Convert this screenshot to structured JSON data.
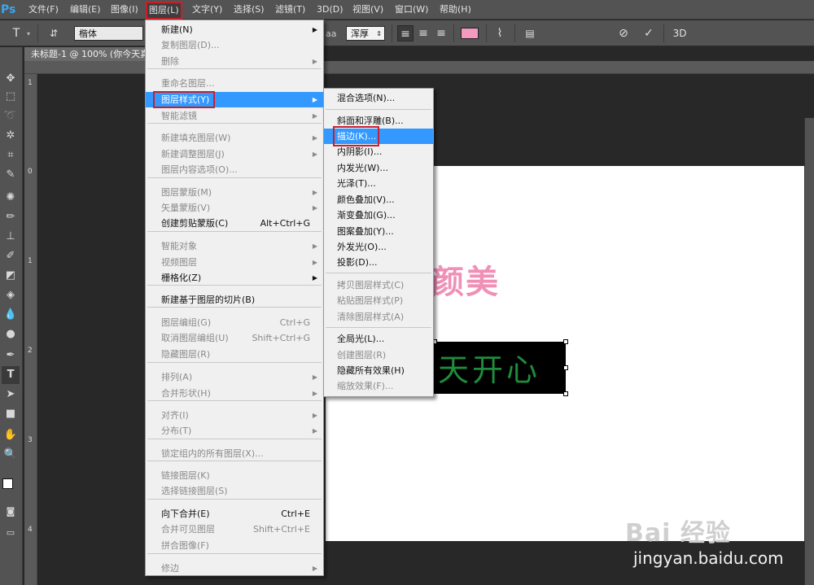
{
  "app": {
    "logo": "Ps"
  },
  "menubar": {
    "items": [
      "文件(F)",
      "编辑(E)",
      "图像(I)",
      "图层(L)",
      "文字(Y)",
      "选择(S)",
      "滤镜(T)",
      "3D(D)",
      "视图(V)",
      "窗口(W)",
      "帮助(H)"
    ]
  },
  "options_bar": {
    "font_family": "楷体",
    "antialias": "浑厚",
    "text_tool_icon": "T",
    "aa_label": "aa",
    "threed_label": "3D",
    "text_color": "#f49ac1"
  },
  "document": {
    "tab_title": "未标题-1 @ 100% (你今天真"
  },
  "ruler": {
    "left_numbers": [
      "1",
      "0",
      "1",
      "2",
      "3",
      "4"
    ]
  },
  "canvas": {
    "pink_text": "颜美",
    "green_text": "天开心",
    "pink_color": "#f090b6",
    "green_color": "#1e8c3c"
  },
  "layer_menu": {
    "items": [
      {
        "label": "新建(N)",
        "shortcut": "",
        "submenu": true,
        "disabled": false
      },
      {
        "label": "复制图层(D)...",
        "shortcut": "",
        "submenu": false,
        "disabled": true
      },
      {
        "label": "删除",
        "shortcut": "",
        "submenu": true,
        "disabled": true
      },
      {
        "label": "重命名图层...",
        "shortcut": "",
        "submenu": false,
        "disabled": true
      },
      {
        "label": "图层样式(Y)",
        "shortcut": "",
        "submenu": true,
        "disabled": false,
        "highlighted": true
      },
      {
        "label": "智能滤镜",
        "shortcut": "",
        "submenu": true,
        "disabled": true
      },
      {
        "label": "新建填充图层(W)",
        "shortcut": "",
        "submenu": true,
        "disabled": true
      },
      {
        "label": "新建调整图层(J)",
        "shortcut": "",
        "submenu": true,
        "disabled": true
      },
      {
        "label": "图层内容选项(O)...",
        "shortcut": "",
        "submenu": false,
        "disabled": true
      },
      {
        "label": "图层蒙版(M)",
        "shortcut": "",
        "submenu": true,
        "disabled": true
      },
      {
        "label": "矢量蒙版(V)",
        "shortcut": "",
        "submenu": true,
        "disabled": true
      },
      {
        "label": "创建剪贴蒙版(C)",
        "shortcut": "Alt+Ctrl+G",
        "submenu": false,
        "disabled": false
      },
      {
        "label": "智能对象",
        "shortcut": "",
        "submenu": true,
        "disabled": true
      },
      {
        "label": "视频图层",
        "shortcut": "",
        "submenu": true,
        "disabled": true
      },
      {
        "label": "栅格化(Z)",
        "shortcut": "",
        "submenu": true,
        "disabled": false
      },
      {
        "label": "新建基于图层的切片(B)",
        "shortcut": "",
        "submenu": false,
        "disabled": false
      },
      {
        "label": "图层编组(G)",
        "shortcut": "Ctrl+G",
        "submenu": false,
        "disabled": true
      },
      {
        "label": "取消图层编组(U)",
        "shortcut": "Shift+Ctrl+G",
        "submenu": false,
        "disabled": true
      },
      {
        "label": "隐藏图层(R)",
        "shortcut": "",
        "submenu": false,
        "disabled": true
      },
      {
        "label": "排列(A)",
        "shortcut": "",
        "submenu": true,
        "disabled": true
      },
      {
        "label": "合并形状(H)",
        "shortcut": "",
        "submenu": true,
        "disabled": true
      },
      {
        "label": "对齐(I)",
        "shortcut": "",
        "submenu": true,
        "disabled": true
      },
      {
        "label": "分布(T)",
        "shortcut": "",
        "submenu": true,
        "disabled": true
      },
      {
        "label": "锁定组内的所有图层(X)...",
        "shortcut": "",
        "submenu": false,
        "disabled": true
      },
      {
        "label": "链接图层(K)",
        "shortcut": "",
        "submenu": false,
        "disabled": true
      },
      {
        "label": "选择链接图层(S)",
        "shortcut": "",
        "submenu": false,
        "disabled": true
      },
      {
        "label": "向下合并(E)",
        "shortcut": "Ctrl+E",
        "submenu": false,
        "disabled": false
      },
      {
        "label": "合并可见图层",
        "shortcut": "Shift+Ctrl+E",
        "submenu": false,
        "disabled": true
      },
      {
        "label": "拼合图像(F)",
        "shortcut": "",
        "submenu": false,
        "disabled": true
      },
      {
        "label": "修边",
        "shortcut": "",
        "submenu": true,
        "disabled": true
      }
    ]
  },
  "style_menu": {
    "items": [
      {
        "label": "混合选项(N)...",
        "disabled": false
      },
      {
        "label": "斜面和浮雕(B)...",
        "disabled": false
      },
      {
        "label": "描边(K)...",
        "disabled": false,
        "highlighted": true
      },
      {
        "label": "内阴影(I)...",
        "disabled": false
      },
      {
        "label": "内发光(W)...",
        "disabled": false
      },
      {
        "label": "光泽(T)...",
        "disabled": false
      },
      {
        "label": "颜色叠加(V)...",
        "disabled": false
      },
      {
        "label": "渐变叠加(G)...",
        "disabled": false
      },
      {
        "label": "图案叠加(Y)...",
        "disabled": false
      },
      {
        "label": "外发光(O)...",
        "disabled": false
      },
      {
        "label": "投影(D)...",
        "disabled": false
      },
      {
        "label": "拷贝图层样式(C)",
        "disabled": true
      },
      {
        "label": "粘贴图层样式(P)",
        "disabled": true
      },
      {
        "label": "清除图层样式(A)",
        "disabled": true
      },
      {
        "label": "全局光(L)...",
        "disabled": false
      },
      {
        "label": "创建图层(R)",
        "disabled": true
      },
      {
        "label": "隐藏所有效果(H)",
        "disabled": false
      },
      {
        "label": "缩放效果(F)...",
        "disabled": true
      }
    ]
  },
  "watermark": {
    "logo": "Bai 经验",
    "url": "jingyan.baidu.com"
  }
}
